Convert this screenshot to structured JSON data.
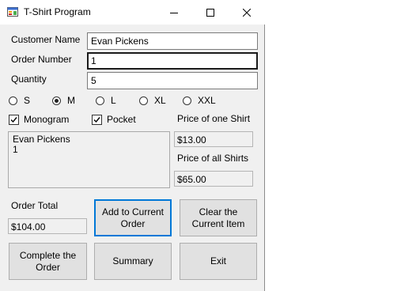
{
  "window": {
    "title": "T-Shirt Program"
  },
  "form": {
    "customer_name_label": "Customer Name",
    "customer_name_value": "Evan Pickens",
    "order_number_label": "Order Number",
    "order_number_value": "1",
    "quantity_label": "Quantity",
    "quantity_value": "5"
  },
  "sizes": [
    {
      "label": "S",
      "selected": false
    },
    {
      "label": "M",
      "selected": true
    },
    {
      "label": "L",
      "selected": false
    },
    {
      "label": "XL",
      "selected": false
    },
    {
      "label": "XXL",
      "selected": false
    }
  ],
  "options": {
    "monogram_label": "Monogram",
    "monogram_checked": true,
    "pocket_label": "Pocket",
    "pocket_checked": true
  },
  "summary_lines": [
    "Evan Pickens",
    "1"
  ],
  "pricing": {
    "one_shirt_label": "Price of one Shirt",
    "one_shirt_value": "$13.00",
    "all_shirts_label": "Price of all Shirts",
    "all_shirts_value": "$65.00",
    "order_total_label": "Order Total",
    "order_total_value": "$104.00"
  },
  "buttons": {
    "add": "Add to Current Order",
    "clear": "Clear the Current Item",
    "complete": "Complete the Order",
    "summary": "Summary",
    "exit": "Exit"
  }
}
